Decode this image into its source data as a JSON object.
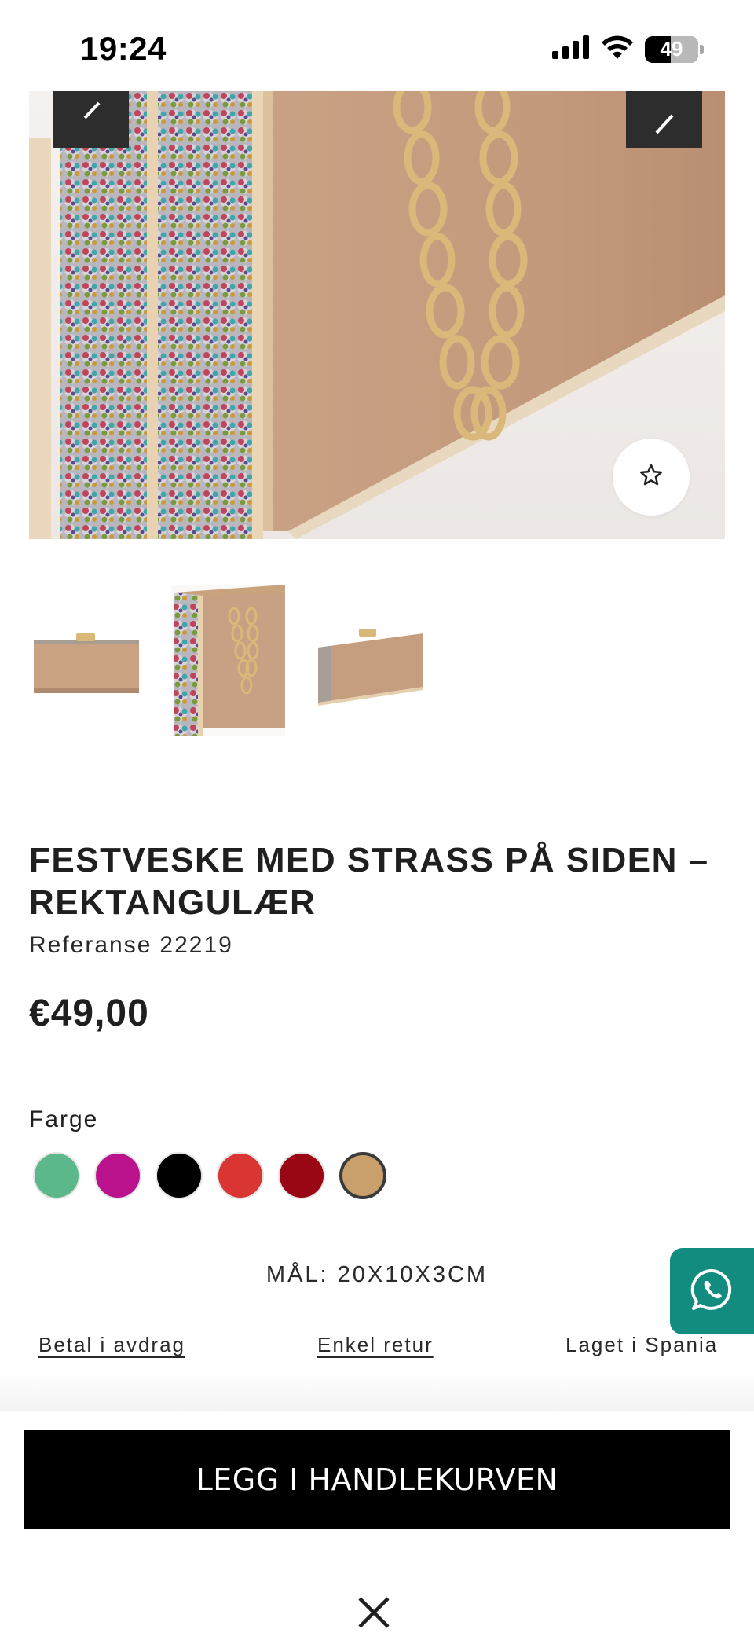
{
  "status_bar": {
    "time": "19:24",
    "battery": "49",
    "battery_level_percent": 49
  },
  "gallery": {
    "main_image_alt": "Festveske med strass på siden – rektangulær",
    "thumbnails": [
      "thumbnail-front",
      "thumbnail-angle-chain",
      "thumbnail-side"
    ],
    "prev_icon": "chevron-left-icon",
    "next_icon": "chevron-right-icon",
    "favorite_icon": "star-outline-icon"
  },
  "product": {
    "title": "FESTVESKE MED STRASS PÅ SIDEN – REKTANGULÆR",
    "reference_label": "Referanse",
    "reference_value": "22219",
    "price": "€49,00"
  },
  "colors": {
    "label": "Farge",
    "swatches": [
      {
        "name": "green",
        "hex": "#5cb88a",
        "selected": false
      },
      {
        "name": "magenta",
        "hex": "#b9128c",
        "selected": false
      },
      {
        "name": "black",
        "hex": "#000000",
        "selected": false
      },
      {
        "name": "red",
        "hex": "#d93533",
        "selected": false
      },
      {
        "name": "dark-red",
        "hex": "#9a0714",
        "selected": false
      },
      {
        "name": "beige",
        "hex": "#c9a06c",
        "selected": true
      }
    ]
  },
  "dimensions": "MÅL: 20X10X3CM",
  "perks": {
    "installments": "Betal i avdrag",
    "returns": "Enkel retur",
    "made_in": "Laget i Spania"
  },
  "whatsapp_icon": "whatsapp-icon",
  "cart": {
    "add_label": "LEGG I HANDLEKURVEN"
  },
  "close_icon": "close-icon"
}
